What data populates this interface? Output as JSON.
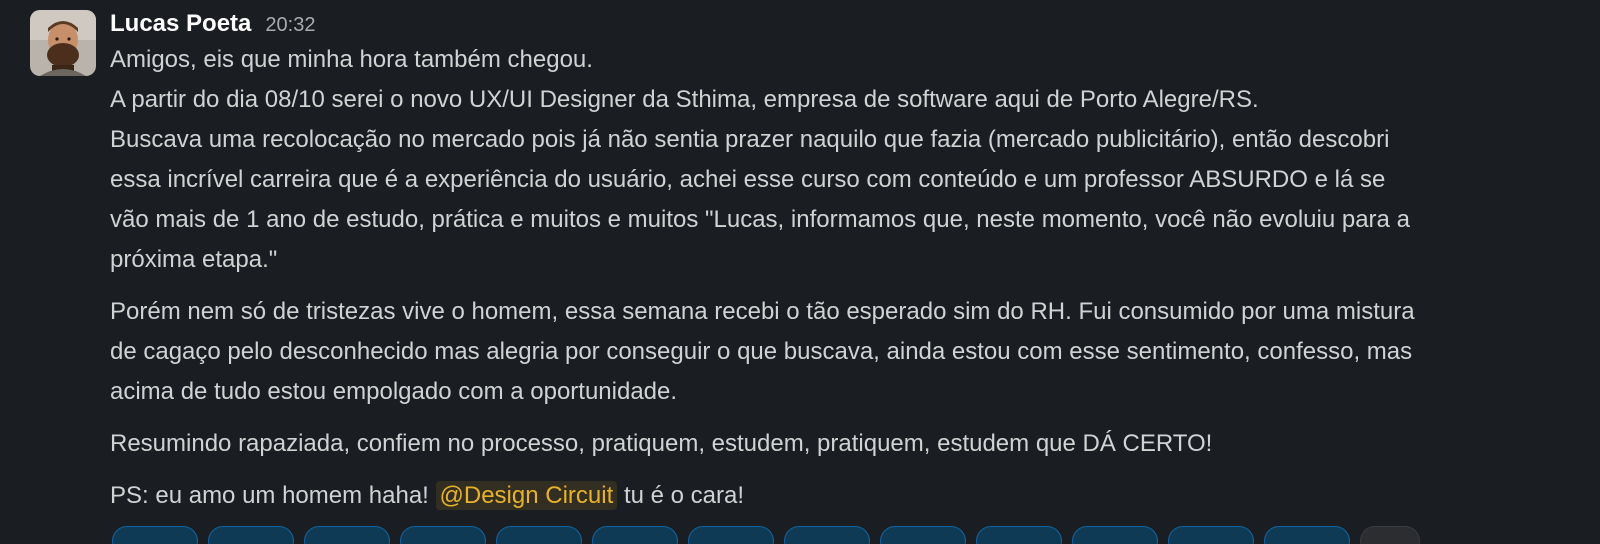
{
  "message": {
    "author": "Lucas Poeta",
    "time": "20:32",
    "paragraphs": [
      [
        "Amigos, eis que minha hora também chegou.",
        "A partir do dia 08/10 serei o novo UX/UI Designer da Sthima, empresa de software aqui de Porto Alegre/RS.",
        "Buscava uma recolocação no mercado pois já não sentia prazer naquilo que fazia (mercado publicitário), então descobri",
        "essa incrível carreira que é a experiência do usuário, achei esse curso com conteúdo e um professor ABSURDO e lá se",
        "vão mais de 1 ano de estudo, prática e muitos e muitos \"Lucas, informamos que, neste momento, você não evoluiu para a",
        "próxima etapa.\""
      ],
      [
        "Porém nem só de tristezas vive o homem, essa semana recebi o tão esperado sim do RH. Fui consumido por uma mistura",
        "de cagaço pelo desconhecido mas alegria por conseguir o que buscava, ainda estou com esse sentimento, confesso, mas",
        "acima de tudo estou empolgado com a oportunidade."
      ],
      [
        "Resumindo rapaziada, confiem no processo, pratiquem, estudem, pratiquem, estudem que DÁ CERTO!"
      ]
    ],
    "ps": {
      "before": "PS: eu amo um homem haha!",
      "mention": "@Design Circuit",
      "after": "tu é o cara!"
    }
  },
  "colors": {
    "background": "#1a1d21",
    "text": "#d1d2d3",
    "author": "#ffffff",
    "mention": "#e8b12a",
    "reaction": "#0f3a55"
  }
}
